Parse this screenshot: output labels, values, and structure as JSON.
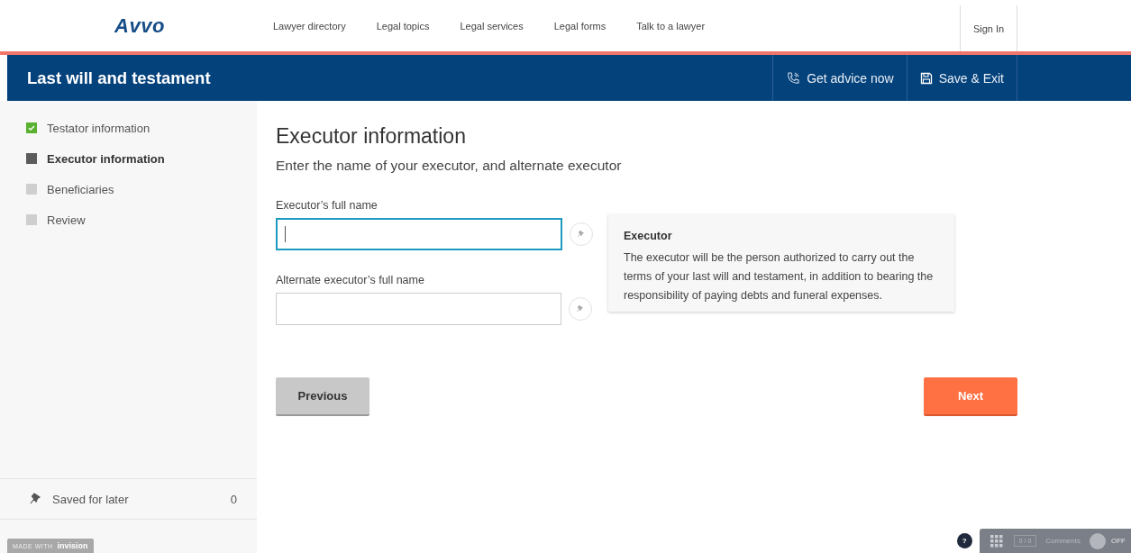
{
  "header": {
    "logo": "Avvo",
    "nav": [
      "Lawyer directory",
      "Legal topics",
      "Legal services",
      "Legal forms",
      "Talk to a lawyer"
    ],
    "sign_in": "Sign In"
  },
  "title_bar": {
    "title": "Last will and testament",
    "actions": [
      {
        "kind": "advice",
        "label": "Get advice now"
      },
      {
        "kind": "save",
        "label": "Save & Exit"
      }
    ]
  },
  "steps": [
    {
      "label": "Testator information",
      "completed": true,
      "selected": false
    },
    {
      "label": "Executor information",
      "completed": false,
      "selected": true
    },
    {
      "label": "Beneficiaries",
      "completed": false,
      "selected": false
    },
    {
      "label": "Review",
      "completed": false,
      "selected": false
    }
  ],
  "saved": {
    "label": "Saved for later",
    "count": "0"
  },
  "form": {
    "heading": "Executor information",
    "subheading": "Enter the name of your executor, and alternate executor",
    "fields": [
      {
        "label": "Executor’s full name",
        "focused": true
      },
      {
        "label": "Alternate executor’s full name",
        "focused": false
      }
    ],
    "help": {
      "title": "Executor",
      "text": "The executor will be the person authorized to carry out the terms of your last will and testament, in addition to bearing the responsibility of paying debts and funeral expenses."
    },
    "previous": "Previous",
    "next": "Next"
  },
  "viewer": {
    "badge_prefix": "MADE WITH",
    "badge_brand": "invision",
    "help": "?",
    "counter": "0 / 0",
    "comments": "Comments",
    "toggle": "OFF",
    "on": false
  }
}
